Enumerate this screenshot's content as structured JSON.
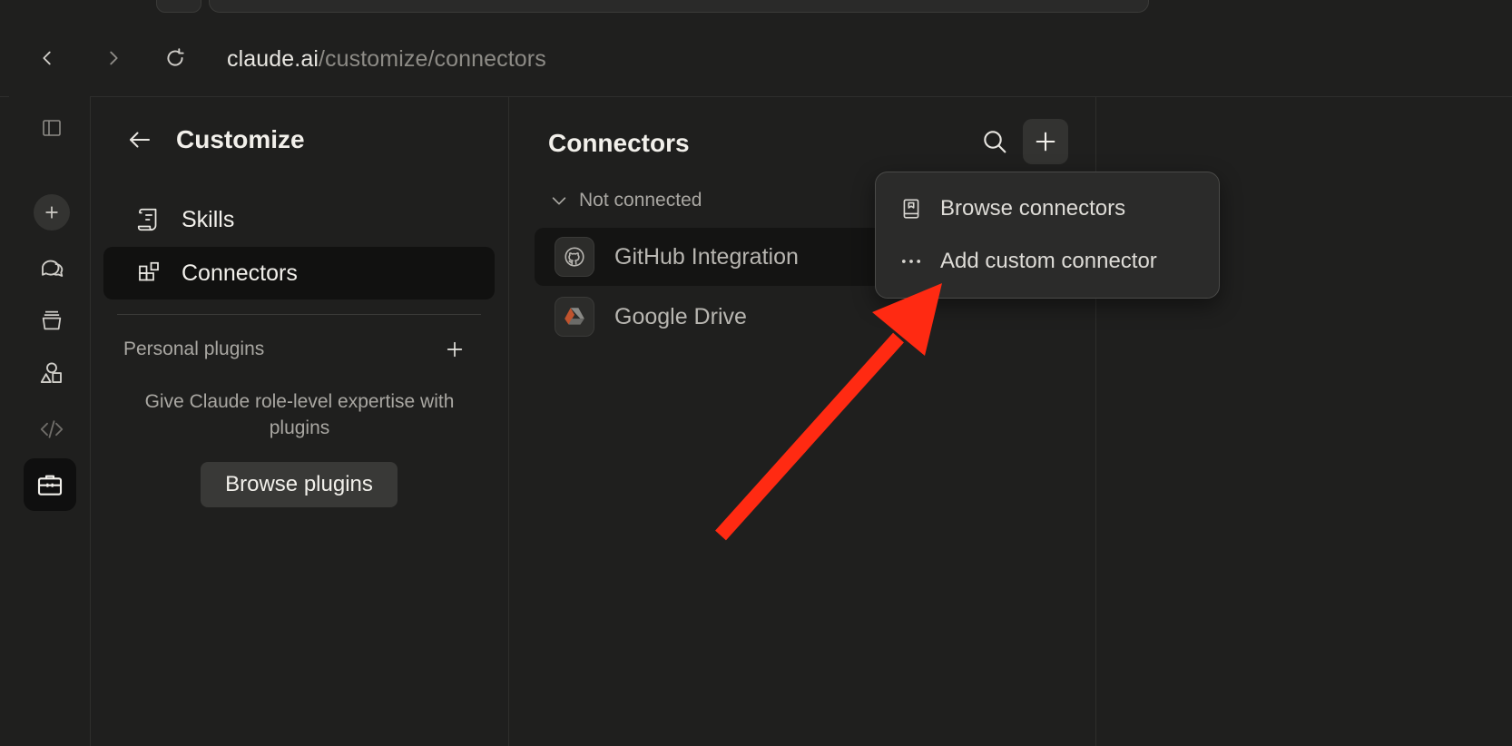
{
  "browser": {
    "url_host": "claude.ai",
    "url_path": "/customize/connectors",
    "back_icon": "chevron-left-icon",
    "forward_icon": "chevron-right-icon",
    "reload_icon": "reload-icon"
  },
  "rail": {
    "items": [
      "sidebar-toggle-icon",
      "new-chat-icon",
      "chats-icon",
      "projects-icon",
      "artifacts-icon",
      "code-icon",
      "customize-icon"
    ]
  },
  "customize": {
    "title": "Customize",
    "menu": [
      {
        "label": "Skills",
        "icon": "skills-icon"
      },
      {
        "label": "Connectors",
        "icon": "connectors-icon",
        "active": true
      }
    ],
    "section_label": "Personal plugins",
    "helper_text": "Give Claude role-level expertise with plugins",
    "browse_button": "Browse plugins"
  },
  "connectors": {
    "title": "Connectors",
    "group_label": "Not connected",
    "items": [
      {
        "label": "GitHub Integration",
        "icon": "github-icon"
      },
      {
        "label": "Google Drive",
        "icon": "google-drive-icon"
      }
    ]
  },
  "dropdown": {
    "items": [
      {
        "label": "Browse connectors",
        "icon": "book-icon"
      },
      {
        "label": "Add custom connector",
        "icon": "more-dots-icon"
      }
    ]
  },
  "annotation": {
    "arrow_color": "#ff2a12"
  },
  "colors": {
    "background": "#1f1f1e",
    "accent_arrow": "#ff2a12"
  }
}
